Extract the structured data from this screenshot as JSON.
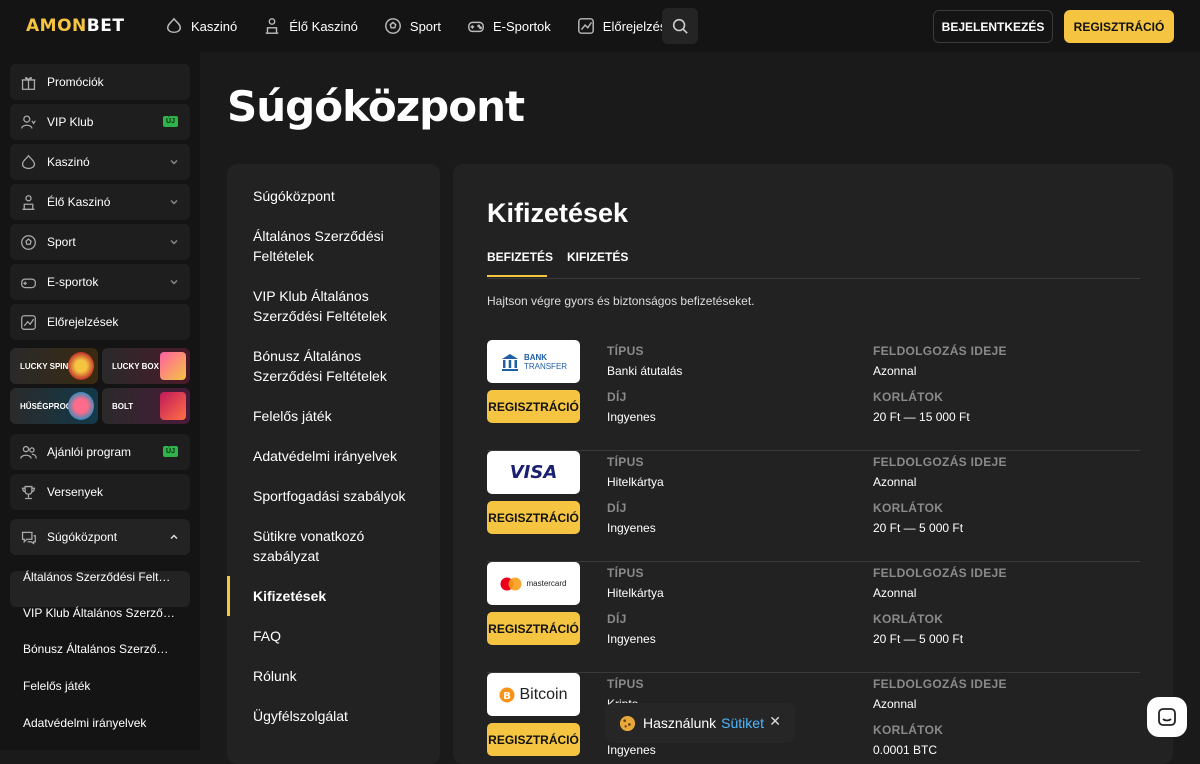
{
  "brand": {
    "logo_accent": "AMON",
    "logo_rest": "BET"
  },
  "topnav": {
    "items": [
      {
        "label": "Kaszinó"
      },
      {
        "label": "Élő Kaszinó"
      },
      {
        "label": "Sport"
      },
      {
        "label": "E-Sportok"
      },
      {
        "label": "Előrejelzések"
      }
    ],
    "login_label": "BEJELENTKEZÉS",
    "register_label": "REGISZTRÁCIÓ"
  },
  "sidebar": {
    "items": [
      {
        "label": "Promóciók"
      },
      {
        "label": "VIP Klub",
        "badge": "ÚJ"
      },
      {
        "label": "Kaszinó"
      },
      {
        "label": "Élő Kaszinó"
      },
      {
        "label": "Sport"
      },
      {
        "label": "E-sportok"
      },
      {
        "label": "Előrejelzések"
      }
    ],
    "tiles": [
      {
        "label": "LUCKY SPIN"
      },
      {
        "label": "LUCKY BOX"
      },
      {
        "label": "HŰSÉGPROG"
      },
      {
        "label": "BOLT"
      }
    ],
    "items2": [
      {
        "label": "Ajánlói program",
        "badge": "ÚJ"
      },
      {
        "label": "Versenyek"
      },
      {
        "label": "Súgóközpont"
      }
    ],
    "subitems": [
      "Általános Szerződési Feltételek",
      "VIP Klub Általános Szerződési Feltételek",
      "Bónusz Általános Szerződési Feltételek",
      "Felelős játék",
      "Adatvédelmi irányelvek"
    ]
  },
  "page": {
    "title": "Súgóközpont"
  },
  "leftnav": {
    "items": [
      "Súgóközpont",
      "Általános Szerződési Feltételek",
      "VIP Klub Általános Szerződési Feltételek",
      "Bónusz Általános Szerződési Feltételek",
      "Felelős játék",
      "Adatvédelmi irányelvek",
      "Sportfogadási szabályok",
      "Sütikre vonatkozó szabályzat",
      "Kifizetések",
      "FAQ",
      "Rólunk",
      "Ügyfélszolgálat"
    ],
    "active": "Kifizetések"
  },
  "content": {
    "title": "Kifizetések",
    "tabs": [
      "BEFIZETÉS",
      "KIFIZETÉS"
    ],
    "active_tab": "BEFIZETÉS",
    "description": "Hajtson végre gyors és biztonságos befizetéseket.",
    "labels": {
      "type": "TÍPUS",
      "fee": "DÍJ",
      "processing": "FELDOLGOZÁS IDEJE",
      "limits": "KORLÁTOK"
    },
    "register_label": "REGISZTRÁCIÓ",
    "methods": [
      {
        "logo_top": "BANK",
        "logo_bottom": "TRANSFER",
        "icon": "bank-transfer-logo",
        "type": "Banki átutalás",
        "fee": "Ingyenes",
        "processing": "Azonnal",
        "limits": "20 Ft — 15 000 Ft"
      },
      {
        "logo_text": "VISA",
        "icon": "visa-logo",
        "type": "Hitelkártya",
        "fee": "Ingyenes",
        "processing": "Azonnal",
        "limits": "20 Ft — 5 000 Ft"
      },
      {
        "logo_text": "mastercard",
        "icon": "mastercard-logo",
        "type": "Hitelkártya",
        "fee": "Ingyenes",
        "processing": "Azonnal",
        "limits": "20 Ft — 5 000 Ft"
      },
      {
        "logo_text": "Bitcoin",
        "icon": "bitcoin-logo",
        "type": "Kripto",
        "fee": "Ingyenes",
        "processing": "Azonnal",
        "limits": "0.0001 BTC"
      }
    ]
  },
  "cookie": {
    "text": "Használunk",
    "link": "Sütiket",
    "close": "✕"
  },
  "colors": {
    "accent": "#f5c542",
    "bg": "#1a1a1a",
    "panel": "#222222",
    "link": "#4fb8ff",
    "badge": "#2fb34a"
  }
}
